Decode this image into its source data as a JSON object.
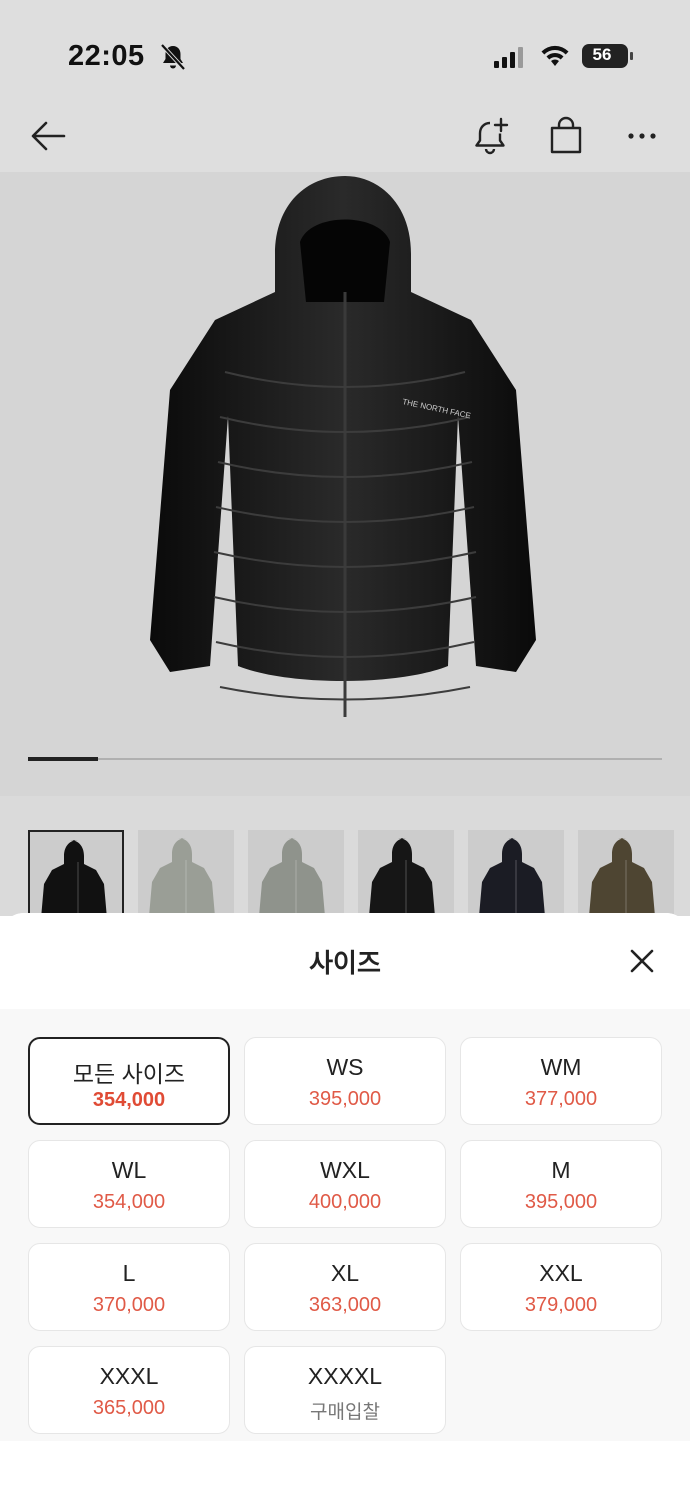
{
  "status_bar": {
    "time": "22:05",
    "battery": "56"
  },
  "sheet": {
    "title": "사이즈",
    "sizes": [
      {
        "name": "모든 사이즈",
        "price": "354,000",
        "selected": true
      },
      {
        "name": "WS",
        "price": "395,000"
      },
      {
        "name": "WM",
        "price": "377,000"
      },
      {
        "name": "WL",
        "price": "354,000"
      },
      {
        "name": "WXL",
        "price": "400,000"
      },
      {
        "name": "M",
        "price": "395,000"
      },
      {
        "name": "L",
        "price": "370,000"
      },
      {
        "name": "XL",
        "price": "363,000"
      },
      {
        "name": "XXL",
        "price": "379,000"
      },
      {
        "name": "XXXL",
        "price": "365,000"
      },
      {
        "name": "XXXXL",
        "price": "구매입찰"
      }
    ]
  },
  "gallery": {
    "progress_fraction": 0.11,
    "thumb_colors": [
      "#111111",
      "#9a9e96",
      "#8f938c",
      "#161616",
      "#1b1c24",
      "#4e4532"
    ]
  },
  "colors": {
    "accent_price": "#e05a47",
    "selected_border": "#222222"
  }
}
